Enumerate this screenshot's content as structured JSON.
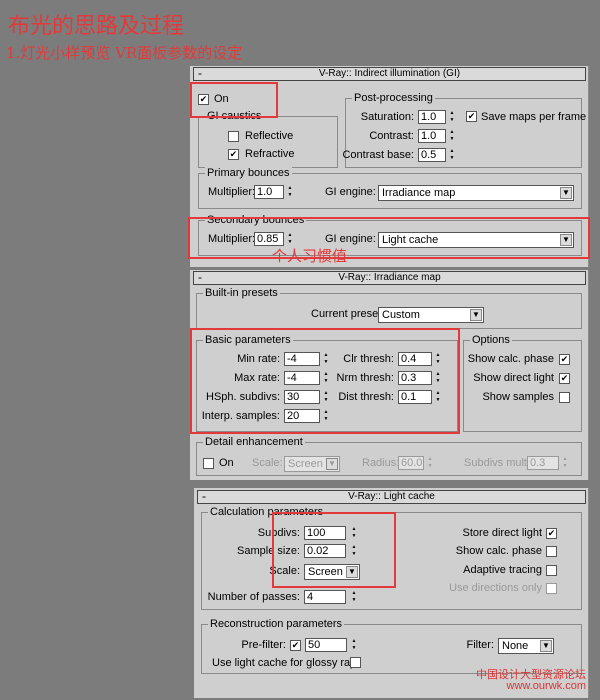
{
  "header": {
    "title": "布光的思路及过程",
    "subtitle": "1.灯光小样预览 VR面板参数的设定"
  },
  "annotation": {
    "habit": "个人习惯值"
  },
  "watermark": {
    "line1": "中国设计大型资源论坛",
    "line2": "www.ourwk.com"
  },
  "gi": {
    "rollout_title": "V-Ray:: Indirect illumination (GI)",
    "on_label": "On",
    "caustics": {
      "label": "GI caustics",
      "reflective_label": "Reflective",
      "refractive_label": "Refractive"
    },
    "post": {
      "label": "Post-processing",
      "saturation_label": "Saturation:",
      "saturation": "1.0",
      "save_maps_label": "Save maps per frame",
      "contrast_label": "Contrast:",
      "contrast": "1.0",
      "contrast_base_label": "Contrast base:",
      "contrast_base": "0.5"
    },
    "primary": {
      "label": "Primary bounces",
      "multiplier_label": "Multiplier:",
      "multiplier": "1.0",
      "engine_label": "GI engine:",
      "engine": "Irradiance map"
    },
    "secondary": {
      "label": "Secondary bounces",
      "multiplier_label": "Multiplier:",
      "multiplier": "0.85",
      "engine_label": "GI engine:",
      "engine": "Light cache"
    }
  },
  "irradiance": {
    "rollout_title": "V-Ray:: Irradiance map",
    "presets": {
      "label": "Built-in presets",
      "current_label": "Current preset:",
      "current": "Custom"
    },
    "basic": {
      "label": "Basic parameters",
      "min_rate_label": "Min rate:",
      "min_rate": "-4",
      "max_rate_label": "Max rate:",
      "max_rate": "-4",
      "hsph_label": "HSph. subdivs:",
      "hsph": "30",
      "interp_label": "Interp. samples:",
      "interp": "20",
      "clr_label": "Clr thresh:",
      "clr": "0.4",
      "nrm_label": "Nrm thresh:",
      "nrm": "0.3",
      "dist_label": "Dist thresh:",
      "dist": "0.1"
    },
    "options": {
      "label": "Options",
      "show_calc_label": "Show calc. phase",
      "show_direct_label": "Show direct light",
      "show_samples_label": "Show samples"
    },
    "detail": {
      "label": "Detail enhancement",
      "on_label": "On",
      "scale_label": "Scale:",
      "scale": "Screen",
      "radius_label": "Radius:",
      "radius": "60.0",
      "subdivs_mult_label": "Subdivs mult.",
      "subdivs_mult": "0.3"
    }
  },
  "lightcache": {
    "rollout_title": "V-Ray:: Light cache",
    "calc": {
      "label": "Calculation parameters",
      "subdivs_label": "Subdivs:",
      "subdivs": "100",
      "sample_size_label": "Sample size:",
      "sample_size": "0.02",
      "scale_label": "Scale:",
      "scale": "Screen",
      "passes_label": "Number of passes:",
      "passes": "4",
      "store_direct_label": "Store direct light",
      "show_calc_label": "Show calc. phase",
      "adaptive_label": "Adaptive tracing",
      "use_directions_label": "Use directions only"
    },
    "recon": {
      "label": "Reconstruction parameters",
      "prefilter_label": "Pre-filter:",
      "prefilter": "50",
      "filter_label": "Filter:",
      "filter": "None",
      "glossy_label": "Use light cache for glossy rays"
    }
  }
}
